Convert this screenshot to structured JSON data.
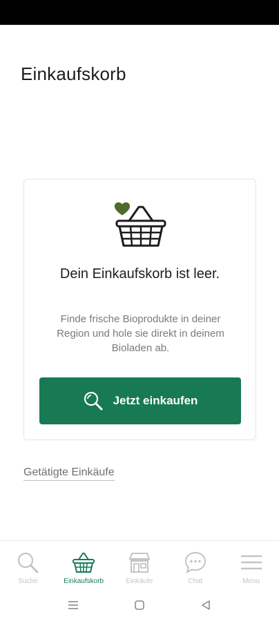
{
  "header": {
    "title": "Einkaufskorb"
  },
  "empty_state": {
    "illustration": "basket-heart-icon",
    "title": "Dein Einkaufskorb ist leer.",
    "text": "Finde frische Bioprodukte in deiner Region und hole sie direkt in deinem Bioladen ab.",
    "cta_label": "Jetzt einkaufen",
    "cta_icon": "search-icon"
  },
  "past_purchases_link": "Getätigte Einkäufe",
  "tabbar": {
    "items": [
      {
        "label": "Suche",
        "icon": "search-icon",
        "active": false
      },
      {
        "label": "Einkaufskorb",
        "icon": "basket-icon",
        "active": true
      },
      {
        "label": "Einkäufe",
        "icon": "store-icon",
        "active": false
      },
      {
        "label": "Chat",
        "icon": "chat-icon",
        "active": false
      },
      {
        "label": "Menu",
        "icon": "menu-icon",
        "active": false
      }
    ]
  },
  "system_nav": {
    "buttons": [
      "recent-apps-icon",
      "home-icon",
      "back-icon"
    ]
  },
  "colors": {
    "accent": "#177a55",
    "heart": "#4e6b2a",
    "inactive": "#c4c4c4",
    "text_muted": "#7a7a7a"
  }
}
